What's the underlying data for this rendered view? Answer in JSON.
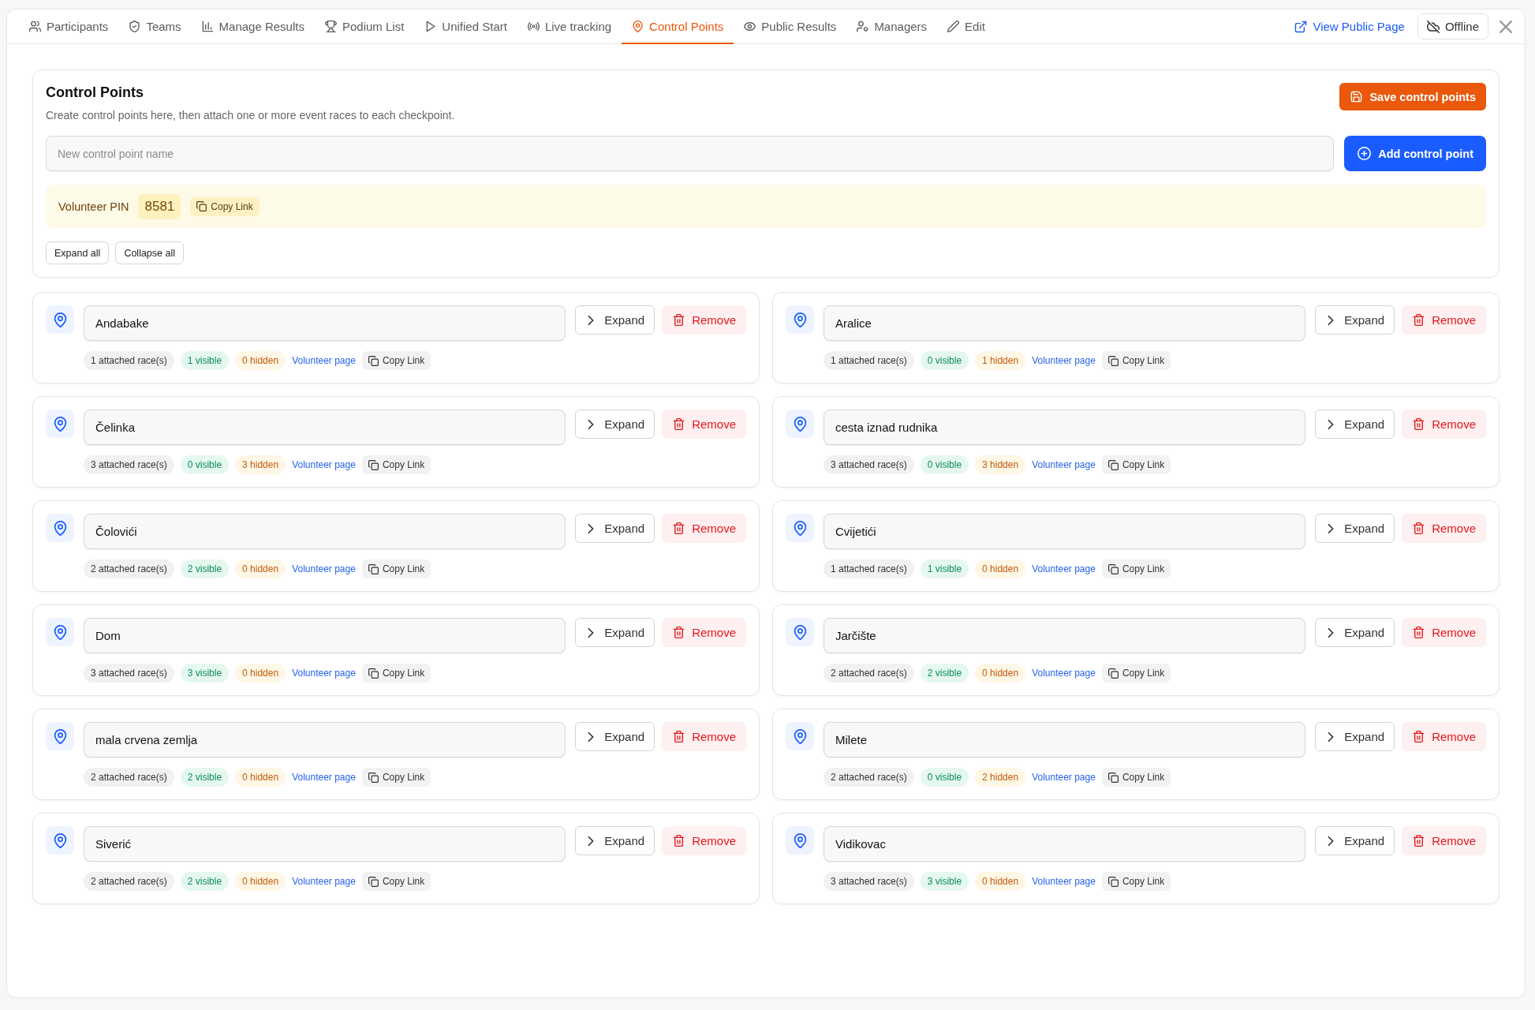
{
  "tabs": [
    {
      "label": "Participants",
      "selected": false
    },
    {
      "label": "Teams",
      "selected": false
    },
    {
      "label": "Manage Results",
      "selected": false
    },
    {
      "label": "Podium List",
      "selected": false
    },
    {
      "label": "Unified Start",
      "selected": false
    },
    {
      "label": "Live tracking",
      "selected": false
    },
    {
      "label": "Control Points",
      "selected": true
    },
    {
      "label": "Public Results",
      "selected": false
    },
    {
      "label": "Managers",
      "selected": false
    },
    {
      "label": "Edit",
      "selected": false
    }
  ],
  "top_actions": {
    "view_public_page": "View Public Page",
    "status_button": "Offline"
  },
  "header": {
    "title": "Control Points",
    "subtitle": "Create control points here, then attach one or more event races to each checkpoint.",
    "save_button": "Save control points",
    "new_point": {
      "placeholder": "New control point name"
    },
    "add_button": "Add control point",
    "pin": {
      "label": "Volunteer PIN",
      "value": "8581",
      "copy_link": "Copy Link"
    },
    "expand_all": "Expand all",
    "collapse_all": "Collapse all"
  },
  "control_points": [
    {
      "name": "Andabake",
      "attached": "1 attached race(s)",
      "visible": "1 visible",
      "hidden": "0 hidden",
      "volunteer_link": "Volunteer page",
      "copy_link": "Copy Link",
      "expand": "Expand",
      "remove": "Remove"
    },
    {
      "name": "Aralice",
      "attached": "1 attached race(s)",
      "visible": "0 visible",
      "hidden": "1 hidden",
      "volunteer_link": "Volunteer page",
      "copy_link": "Copy Link",
      "expand": "Expand",
      "remove": "Remove"
    },
    {
      "name": "Čelinka",
      "attached": "3 attached race(s)",
      "visible": "0 visible",
      "hidden": "3 hidden",
      "volunteer_link": "Volunteer page",
      "copy_link": "Copy Link",
      "expand": "Expand",
      "remove": "Remove"
    },
    {
      "name": "cesta iznad rudnika",
      "attached": "3 attached race(s)",
      "visible": "0 visible",
      "hidden": "3 hidden",
      "volunteer_link": "Volunteer page",
      "copy_link": "Copy Link",
      "expand": "Expand",
      "remove": "Remove"
    },
    {
      "name": "Čolovići",
      "attached": "2 attached race(s)",
      "visible": "2 visible",
      "hidden": "0 hidden",
      "volunteer_link": "Volunteer page",
      "copy_link": "Copy Link",
      "expand": "Expand",
      "remove": "Remove"
    },
    {
      "name": "Cvijetići",
      "attached": "1 attached race(s)",
      "visible": "1 visible",
      "hidden": "0 hidden",
      "volunteer_link": "Volunteer page",
      "copy_link": "Copy Link",
      "expand": "Expand",
      "remove": "Remove"
    },
    {
      "name": "Dom",
      "attached": "3 attached race(s)",
      "visible": "3 visible",
      "hidden": "0 hidden",
      "volunteer_link": "Volunteer page",
      "copy_link": "Copy Link",
      "expand": "Expand",
      "remove": "Remove"
    },
    {
      "name": "Jarčište",
      "attached": "2 attached race(s)",
      "visible": "2 visible",
      "hidden": "0 hidden",
      "volunteer_link": "Volunteer page",
      "copy_link": "Copy Link",
      "expand": "Expand",
      "remove": "Remove"
    },
    {
      "name": "mala crvena zemlja",
      "attached": "2 attached race(s)",
      "visible": "2 visible",
      "hidden": "0 hidden",
      "volunteer_link": "Volunteer page",
      "copy_link": "Copy Link",
      "expand": "Expand",
      "remove": "Remove"
    },
    {
      "name": "Milete",
      "attached": "2 attached race(s)",
      "visible": "0 visible",
      "hidden": "2 hidden",
      "volunteer_link": "Volunteer page",
      "copy_link": "Copy Link",
      "expand": "Expand",
      "remove": "Remove"
    },
    {
      "name": "Siverić",
      "attached": "2 attached race(s)",
      "visible": "2 visible",
      "hidden": "0 hidden",
      "volunteer_link": "Volunteer page",
      "copy_link": "Copy Link",
      "expand": "Expand",
      "remove": "Remove"
    },
    {
      "name": "Vidikovac",
      "attached": "3 attached race(s)",
      "visible": "3 visible",
      "hidden": "0 hidden",
      "volunteer_link": "Volunteer page",
      "copy_link": "Copy Link",
      "expand": "Expand",
      "remove": "Remove"
    }
  ]
}
